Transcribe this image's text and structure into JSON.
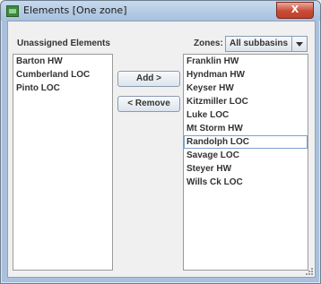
{
  "window": {
    "title": "Elements [One zone]",
    "close_label": "X"
  },
  "left": {
    "label": "Unassigned Elements",
    "items": [
      "Barton HW",
      "Cumberland LOC",
      "Pinto LOC"
    ]
  },
  "buttons": {
    "add": "Add >",
    "remove": "< Remove"
  },
  "right": {
    "label": "Zones:",
    "select_value": "All subbasins",
    "items": [
      "Franklin HW",
      "Hyndman HW",
      "Keyser HW",
      "Kitzmiller LOC",
      "Luke LOC",
      "Mt Storm HW",
      "Randolph LOC",
      "Savage LOC",
      "Steyer HW",
      "Wills Ck LOC"
    ],
    "focused_index": 6
  }
}
